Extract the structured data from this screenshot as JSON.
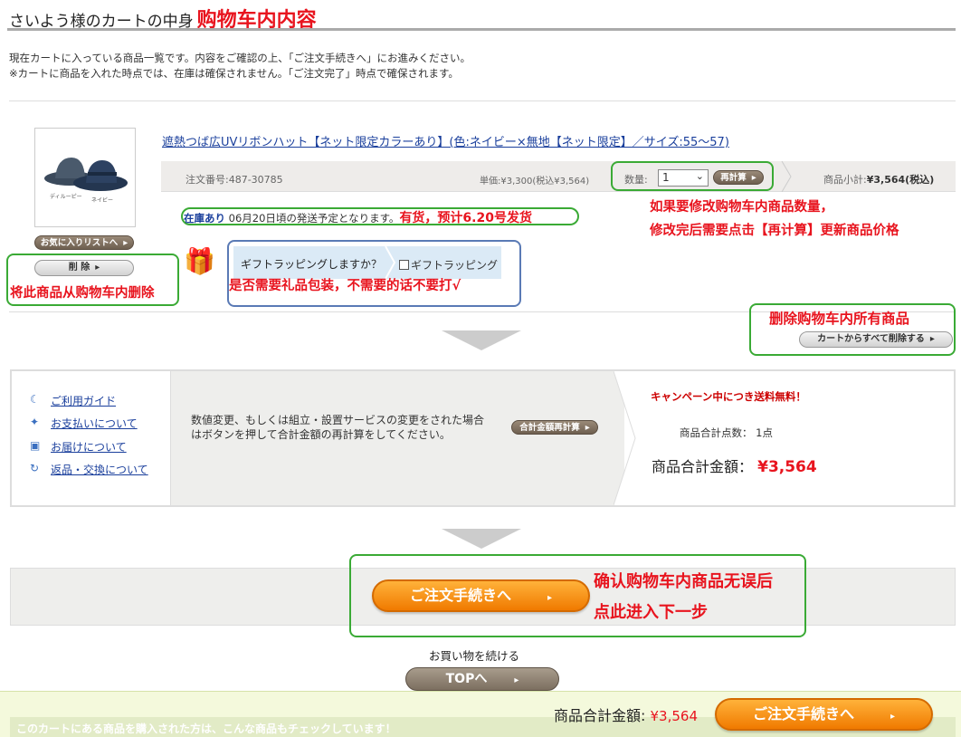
{
  "header": {
    "title": "さいよう様のカートの中身",
    "annotation": "购物车内内容"
  },
  "intro": {
    "line1": "現在カートに入っている商品一覧です。内容をご確認の上、「ご注文手続きへ」にお進みください。",
    "line2": "※カートに商品を入れた時点では、在庫は確保されません。「ご注文完了」時点で確保されます。"
  },
  "product": {
    "name": "遮熱つば広UVリボンハット【ネット限定カラーあり】(色:ネイビー×無地【ネット限定】／サイズ:55〜57)",
    "thumb_labels": [
      "ディルーピー",
      "ネイビー"
    ],
    "order_no": "注文番号:487-30785",
    "unit_price": "単価:¥3,300(税込¥3,564)",
    "qty_label": "数量:",
    "qty_value": "1",
    "recalc": "再計算",
    "subtotal_label": "商品小計:",
    "subtotal_value": "¥3,564(税込)",
    "stock_status": "在庫あり",
    "stock_text": "06月20日頃の発送予定となります。",
    "stock_note": "有货，预计6.20号发货",
    "favorite_button": "お気に入りリストへ",
    "delete_button": "削 除",
    "delete_note": "将此商品从购物车内删除",
    "qty_note_1": "如果要修改购物车内商品数量，",
    "qty_note_2": "修改完后需要点击【再计算】更新商品价格"
  },
  "gift": {
    "question": "ギフトラッピングしますか？",
    "checkbox_label": "ギフトラッピング",
    "note": "是否需要礼品包装，不需要的话不要打√"
  },
  "delete_all": {
    "note": "删除购物车内所有商品",
    "button": "カートからすべて削除する"
  },
  "guide_links": [
    {
      "icon": "help-icon",
      "label": "ご利用ガイド"
    },
    {
      "icon": "payment-icon",
      "label": "お支払いについて"
    },
    {
      "icon": "delivery-icon",
      "label": "お届けについて"
    },
    {
      "icon": "return-icon",
      "label": "返品・交換について"
    }
  ],
  "summary": {
    "recalc_text_1": "数値変更、もしくは組立・設置サービスの変更をされた場合",
    "recalc_text_2": "はボタンを押して合計金額の再計算をしてください。",
    "total_recalc_button": "合計金額再計算",
    "campaign": "キャンペーン中につき送料無料！",
    "item_count_label": "商品合計点数：",
    "item_count": "1点",
    "total_label": "商品合計金額：",
    "total_value": "¥3,564"
  },
  "checkout": {
    "button": "ご注文手続きへ",
    "note_1": "确认购物车内商品无误后",
    "note_2": "点此进入下一步",
    "continue_label": "お買い物を続ける",
    "top_button": "TOPへ"
  },
  "bottom_bar": {
    "total_label": "商品合計金額:",
    "total_value": "¥3,564",
    "button": "ご注文手続きへ",
    "reco_text": "このカートにある商品を購入された方は、こんな商品もチェックしています！"
  },
  "colors": {
    "annotation_red": "#e8141e",
    "annotation_green": "#3aaa35",
    "link_blue": "#1a3f9c",
    "checkout_orange": "#f07a00"
  }
}
